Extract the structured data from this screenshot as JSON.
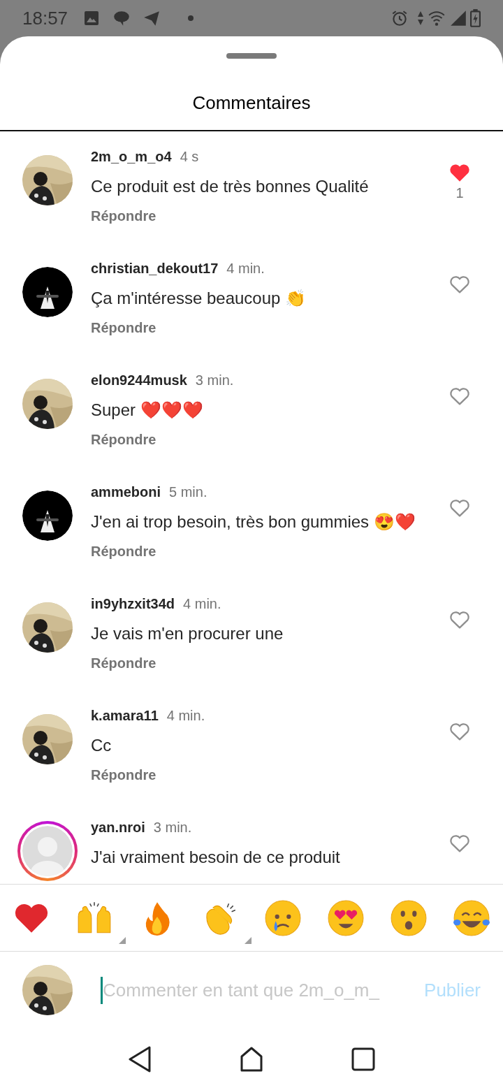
{
  "status_bar": {
    "time": "18:57"
  },
  "sheet": {
    "title": "Commentaires"
  },
  "comments": [
    {
      "username": "2m_o_m_o4",
      "time": "4 s",
      "text": "Ce produit est de très bonnes Qualité",
      "reply": "Répondre",
      "liked": true,
      "likes": "1",
      "has_story": false
    },
    {
      "username": "christian_dekout17",
      "time": "4 min.",
      "text": "Ça m'intéresse beaucoup 👏",
      "reply": "Répondre",
      "liked": false,
      "has_story": false
    },
    {
      "username": "elon9244musk",
      "time": "3 min.",
      "text": "Super ❤️❤️❤️",
      "reply": "Répondre",
      "liked": false,
      "has_story": false
    },
    {
      "username": "ammeboni",
      "time": "5 min.",
      "text": "J'en ai trop besoin, très bon gummies 😍❤️",
      "reply": "Répondre",
      "liked": false,
      "has_story": false
    },
    {
      "username": "in9yhzxit34d",
      "time": "4 min.",
      "text": "Je vais m'en procurer une",
      "reply": "Répondre",
      "liked": false,
      "has_story": false
    },
    {
      "username": "k.amara11",
      "time": "4 min.",
      "text": "Cc",
      "reply": "Répondre",
      "liked": false,
      "has_story": false
    },
    {
      "username": "yan.nroi",
      "time": "3 min.",
      "text": "J'ai vraiment besoin de ce produit",
      "liked": false,
      "has_story": true
    }
  ],
  "reactions": [
    {
      "kind": "heart",
      "has_variants": false
    },
    {
      "kind": "raised_hands",
      "has_variants": true
    },
    {
      "kind": "fire",
      "has_variants": false
    },
    {
      "kind": "clap",
      "has_variants": true
    },
    {
      "kind": "crying",
      "has_variants": false
    },
    {
      "kind": "heart_eyes",
      "has_variants": false
    },
    {
      "kind": "surprised",
      "has_variants": false
    },
    {
      "kind": "laughing",
      "has_variants": false
    }
  ],
  "composer": {
    "placeholder": "Commenter en tant que 2m_o_m_",
    "submit": "Publier",
    "disabled": true
  }
}
